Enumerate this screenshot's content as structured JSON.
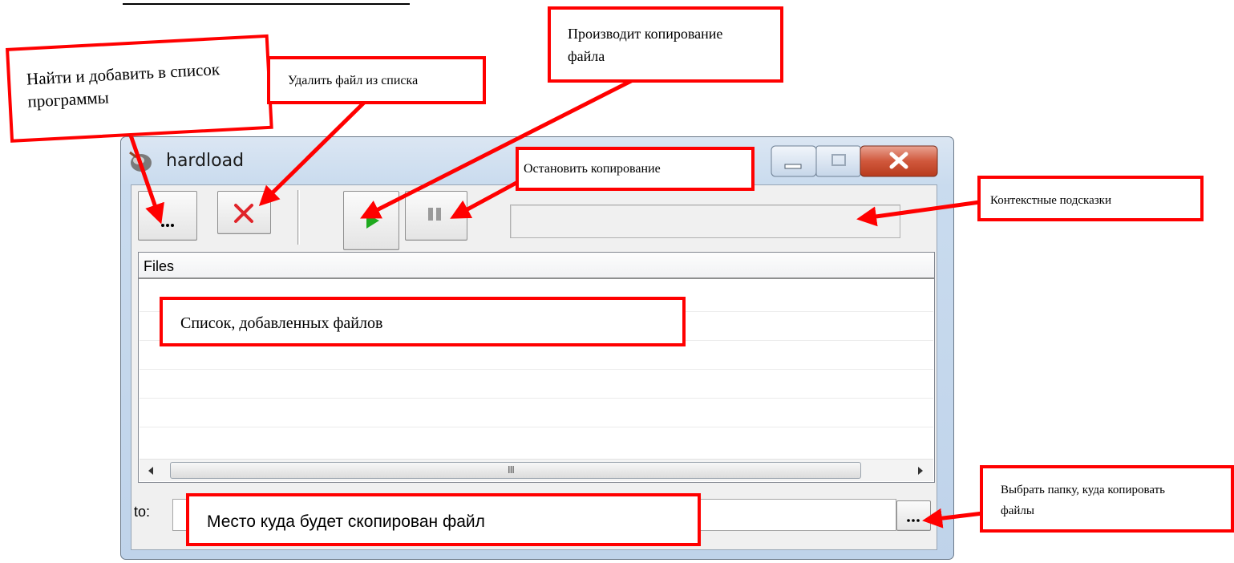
{
  "window": {
    "title": "hardload",
    "list_header": "Files",
    "to_label": "to:",
    "scroll_grip": "III"
  },
  "annotations": {
    "add": "Найти и добавить в список программы",
    "delete": "Удалить файл из списка",
    "copy": "Производит копирование файла",
    "stop": "Остановить копирование",
    "hints": "Контекстные подсказки",
    "list": "Список, добавленных файлов",
    "dest": "Место куда будет скопирован файл",
    "folder": "Выбрать папку, куда копировать файлы"
  },
  "colors": {
    "annotation_red": "#ff0000",
    "window_blue": "#c9dbee"
  },
  "icons": [
    "app-icon",
    "ellipsis-icon",
    "delete-x-icon",
    "play-icon",
    "pause-icon",
    "minimize-icon",
    "maximize-icon",
    "close-icon",
    "scroll-left-icon",
    "scroll-right-icon"
  ]
}
